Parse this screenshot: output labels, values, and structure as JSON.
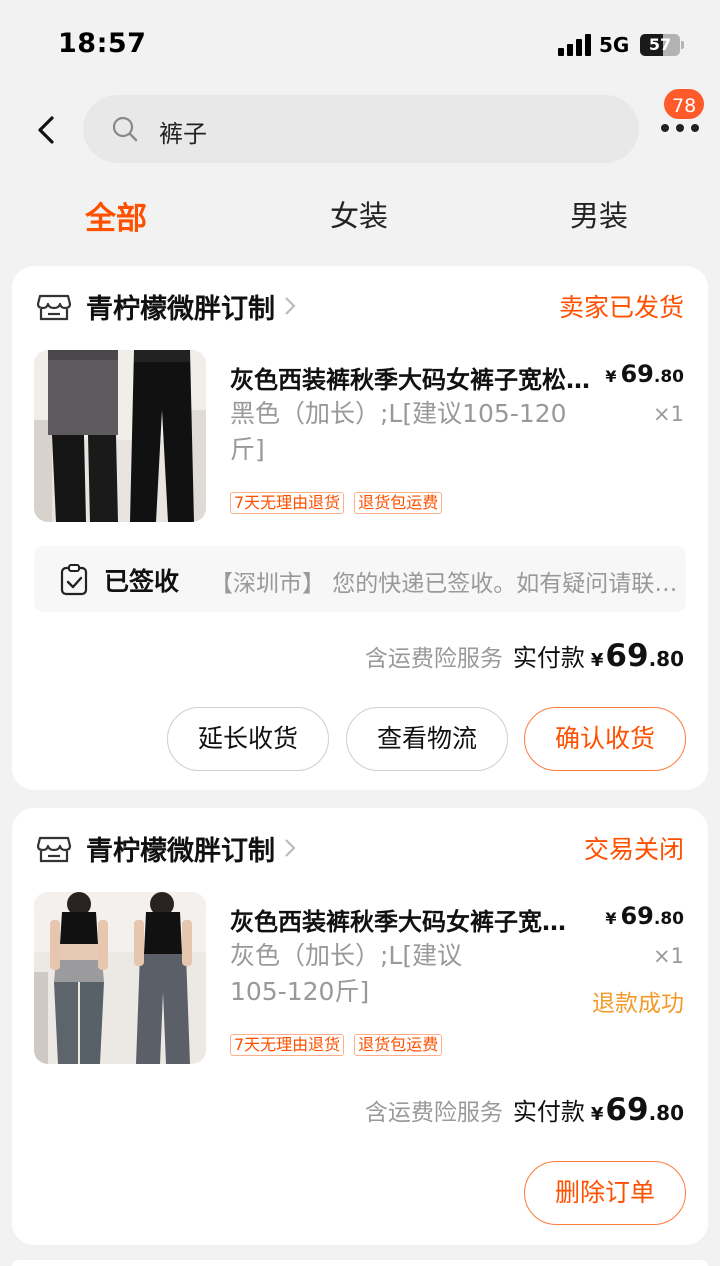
{
  "status_bar": {
    "time": "18:57",
    "network": "5G",
    "battery": "57",
    "battery_level": 0.57
  },
  "header": {
    "search_text": "裤子",
    "badge_count": "78"
  },
  "tabs": [
    {
      "label": "全部",
      "active": true
    },
    {
      "label": "女装",
      "active": false
    },
    {
      "label": "男装",
      "active": false
    }
  ],
  "orders": [
    {
      "shop": "青柠檬微胖订制",
      "status": "卖家已发货",
      "product": {
        "title": "灰色西装裤秋季大码女裤子宽松显瘦阔腿裤",
        "spec": "黑色（加长）;L[建议105-120斤]",
        "price_yen": "¥",
        "price_int": "69",
        "price_dec": ".80",
        "qty": "×1",
        "tags": [
          "7天无理由退货",
          "退货包运费"
        ]
      },
      "logistics": {
        "state": "已签收",
        "text": "【深圳市】 您的快递已签收。如有疑问请联系快递员"
      },
      "payment": {
        "insurance": "含运费险服务",
        "label": "实付款",
        "yen": "¥",
        "int": "69",
        "dec": ".80"
      },
      "buttons": [
        "延长收货",
        "查看物流",
        "确认收货"
      ]
    },
    {
      "shop": "青柠檬微胖订制",
      "status": "交易关闭",
      "product": {
        "title": "灰色西装裤秋季大码女裤子宽松显瘦阔腿裤",
        "spec": "灰色（加长）;L[建议105-120斤]",
        "price_yen": "¥",
        "price_int": "69",
        "price_dec": ".80",
        "qty": "×1",
        "refund": "退款成功",
        "tags": [
          "7天无理由退货",
          "退货包运费"
        ]
      },
      "payment": {
        "insurance": "含运费险服务",
        "label": "实付款",
        "yen": "¥",
        "int": "69",
        "dec": ".80"
      },
      "buttons": [
        "删除订单"
      ]
    }
  ],
  "colors": {
    "accent": "#ff5000",
    "refund": "#f39a2a",
    "badge": "#ff5a2a",
    "background": "#f2f2f2"
  }
}
